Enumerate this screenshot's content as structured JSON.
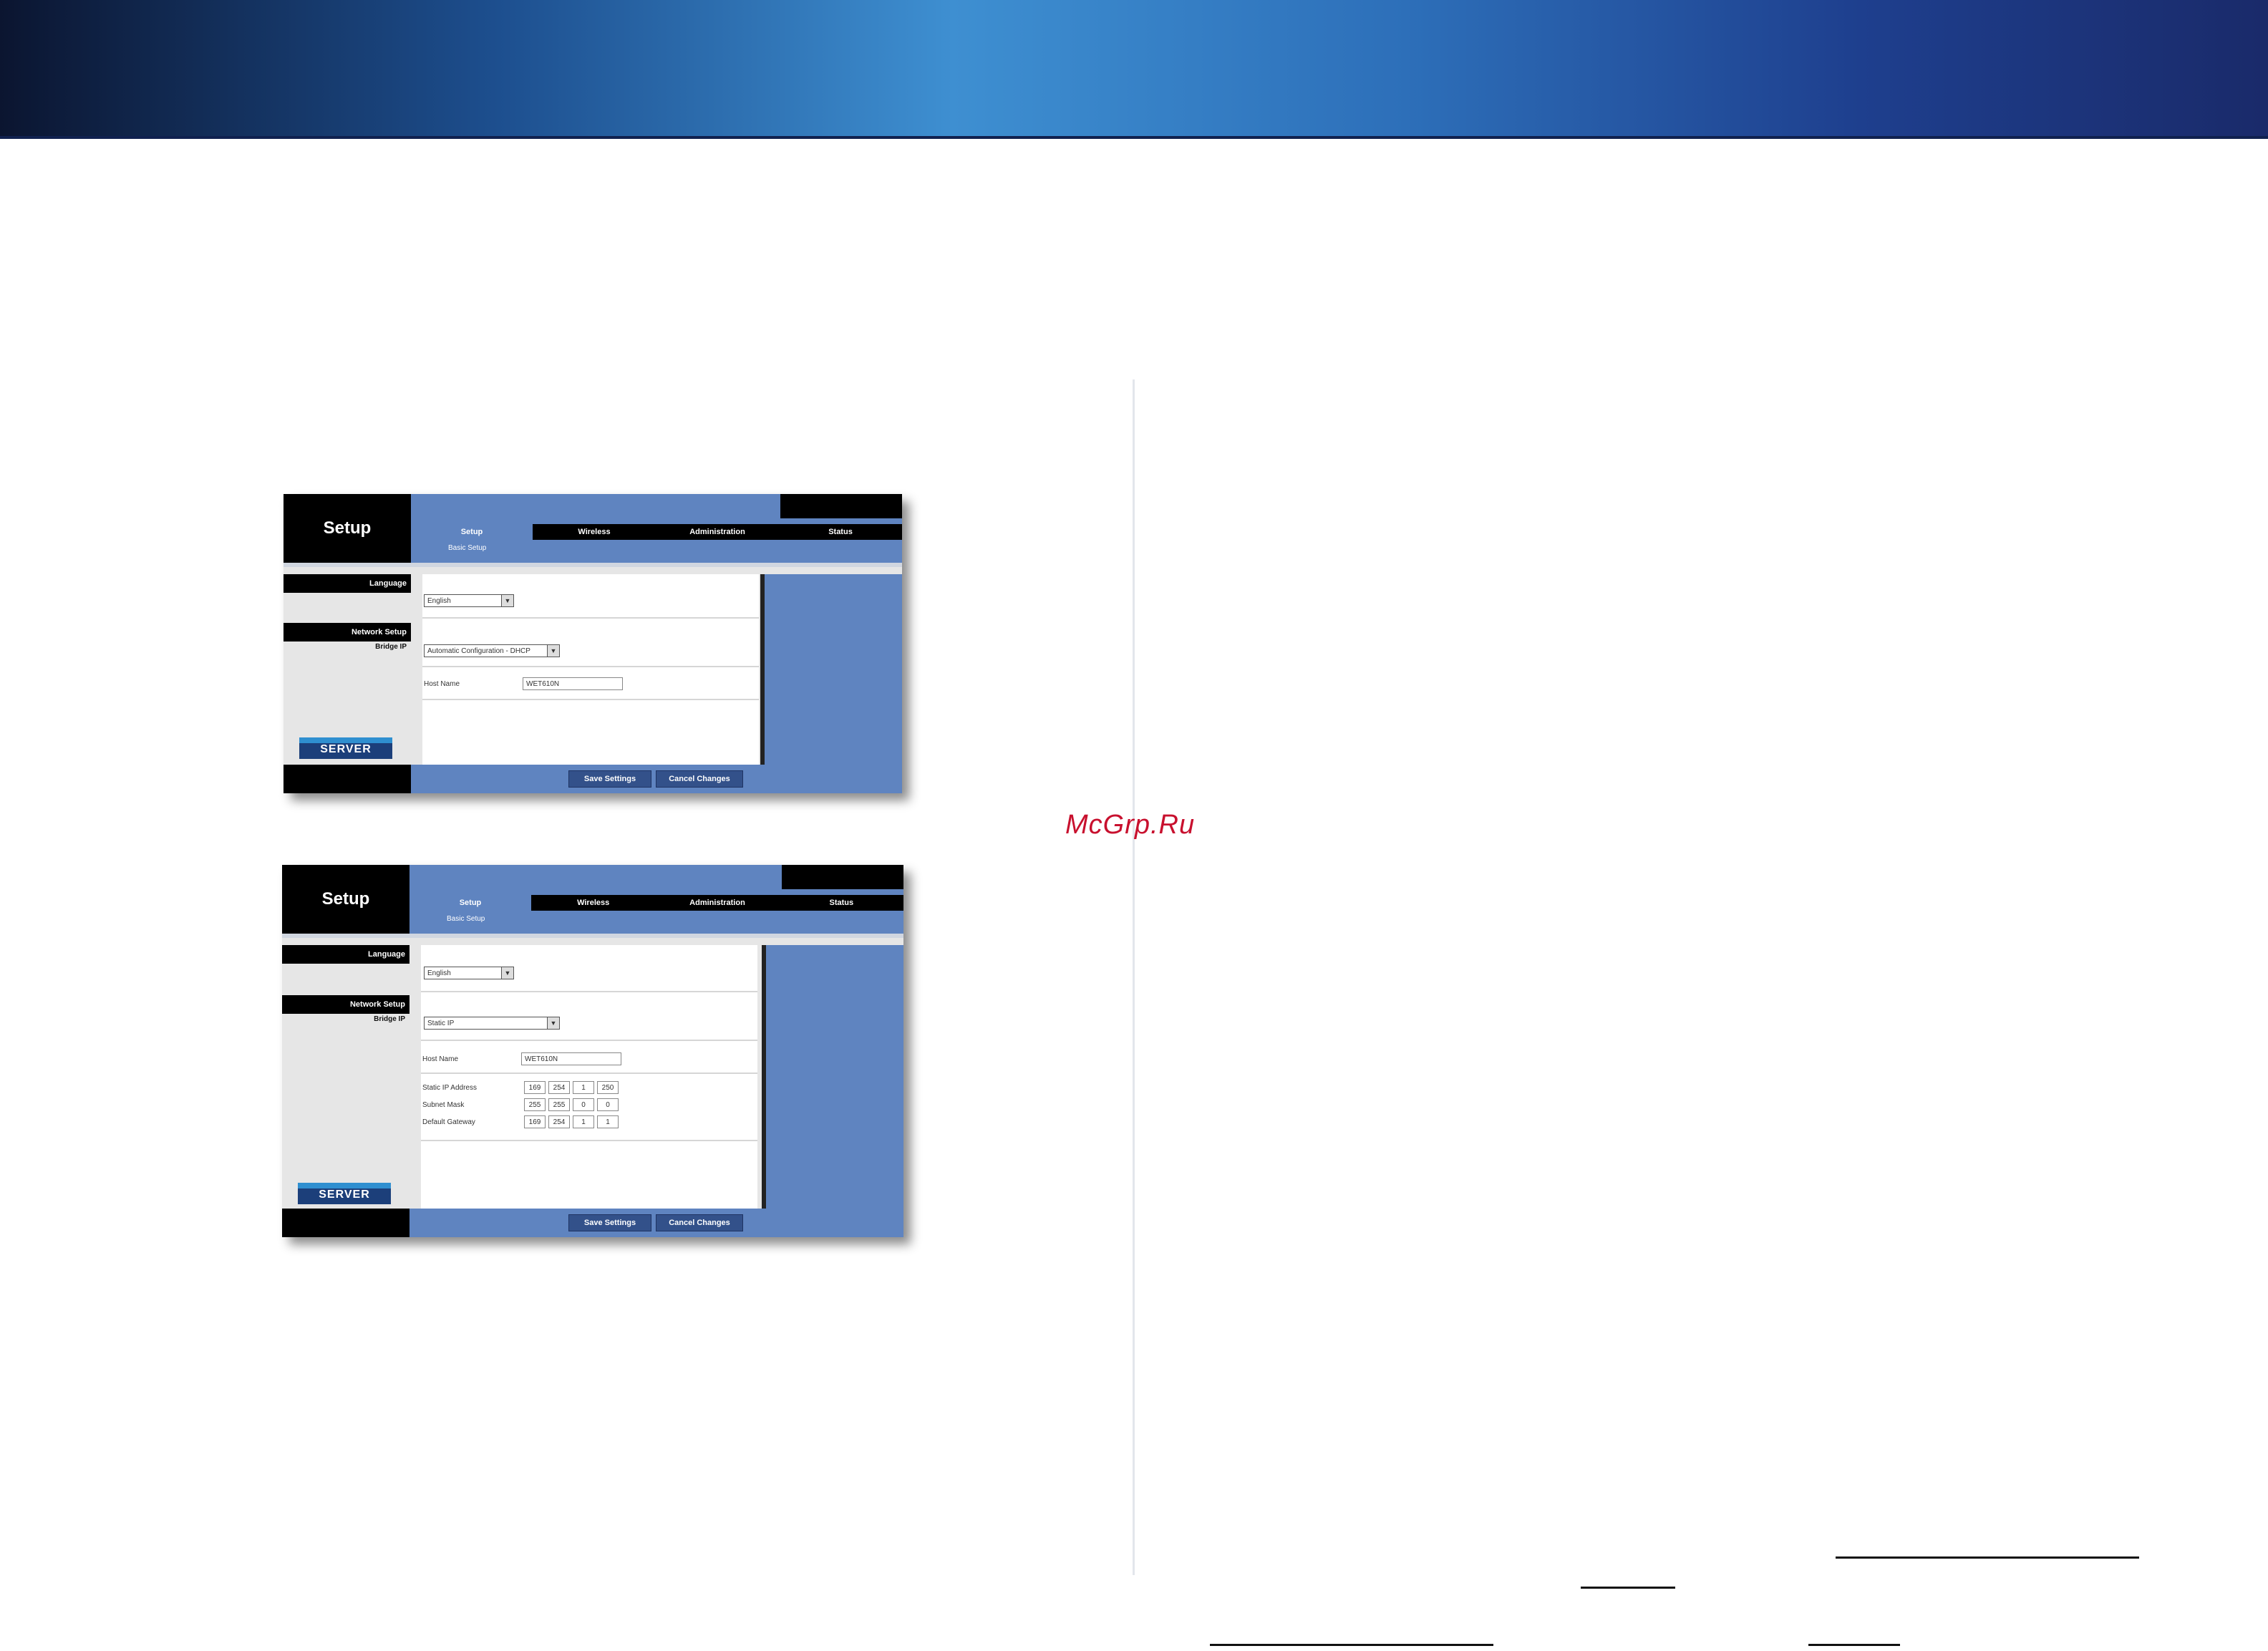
{
  "watermark": "McGrp.Ru",
  "screen_dhcp": {
    "brand": "Setup",
    "tabs": [
      "Setup",
      "Wireless",
      "Administration",
      "Status"
    ],
    "subtab": "Basic Setup",
    "sidebar": {
      "language": "Language",
      "network_setup": "Network Setup",
      "bridge_ip": "Bridge IP"
    },
    "language_value": "English",
    "ip_mode_value": "Automatic Configuration - DHCP",
    "host_name_label": "Host Name",
    "host_name_value": "WET610N",
    "save_button": "Save Settings",
    "cancel_button": "Cancel Changes",
    "badge": "SERVER"
  },
  "screen_static": {
    "brand": "Setup",
    "tabs": [
      "Setup",
      "Wireless",
      "Administration",
      "Status"
    ],
    "subtab": "Basic Setup",
    "sidebar": {
      "language": "Language",
      "network_setup": "Network Setup",
      "bridge_ip": "Bridge IP"
    },
    "language_value": "English",
    "ip_mode_value": "Static IP",
    "host_name_label": "Host Name",
    "host_name_value": "WET610N",
    "static_ip_label": "Static IP Address",
    "static_ip": [
      "169",
      "254",
      "1",
      "250"
    ],
    "subnet_label": "Subnet Mask",
    "subnet": [
      "255",
      "255",
      "0",
      "0"
    ],
    "gateway_label": "Default Gateway",
    "gateway": [
      "169",
      "254",
      "1",
      "1"
    ],
    "save_button": "Save Settings",
    "cancel_button": "Cancel Changes",
    "badge": "SERVER"
  }
}
